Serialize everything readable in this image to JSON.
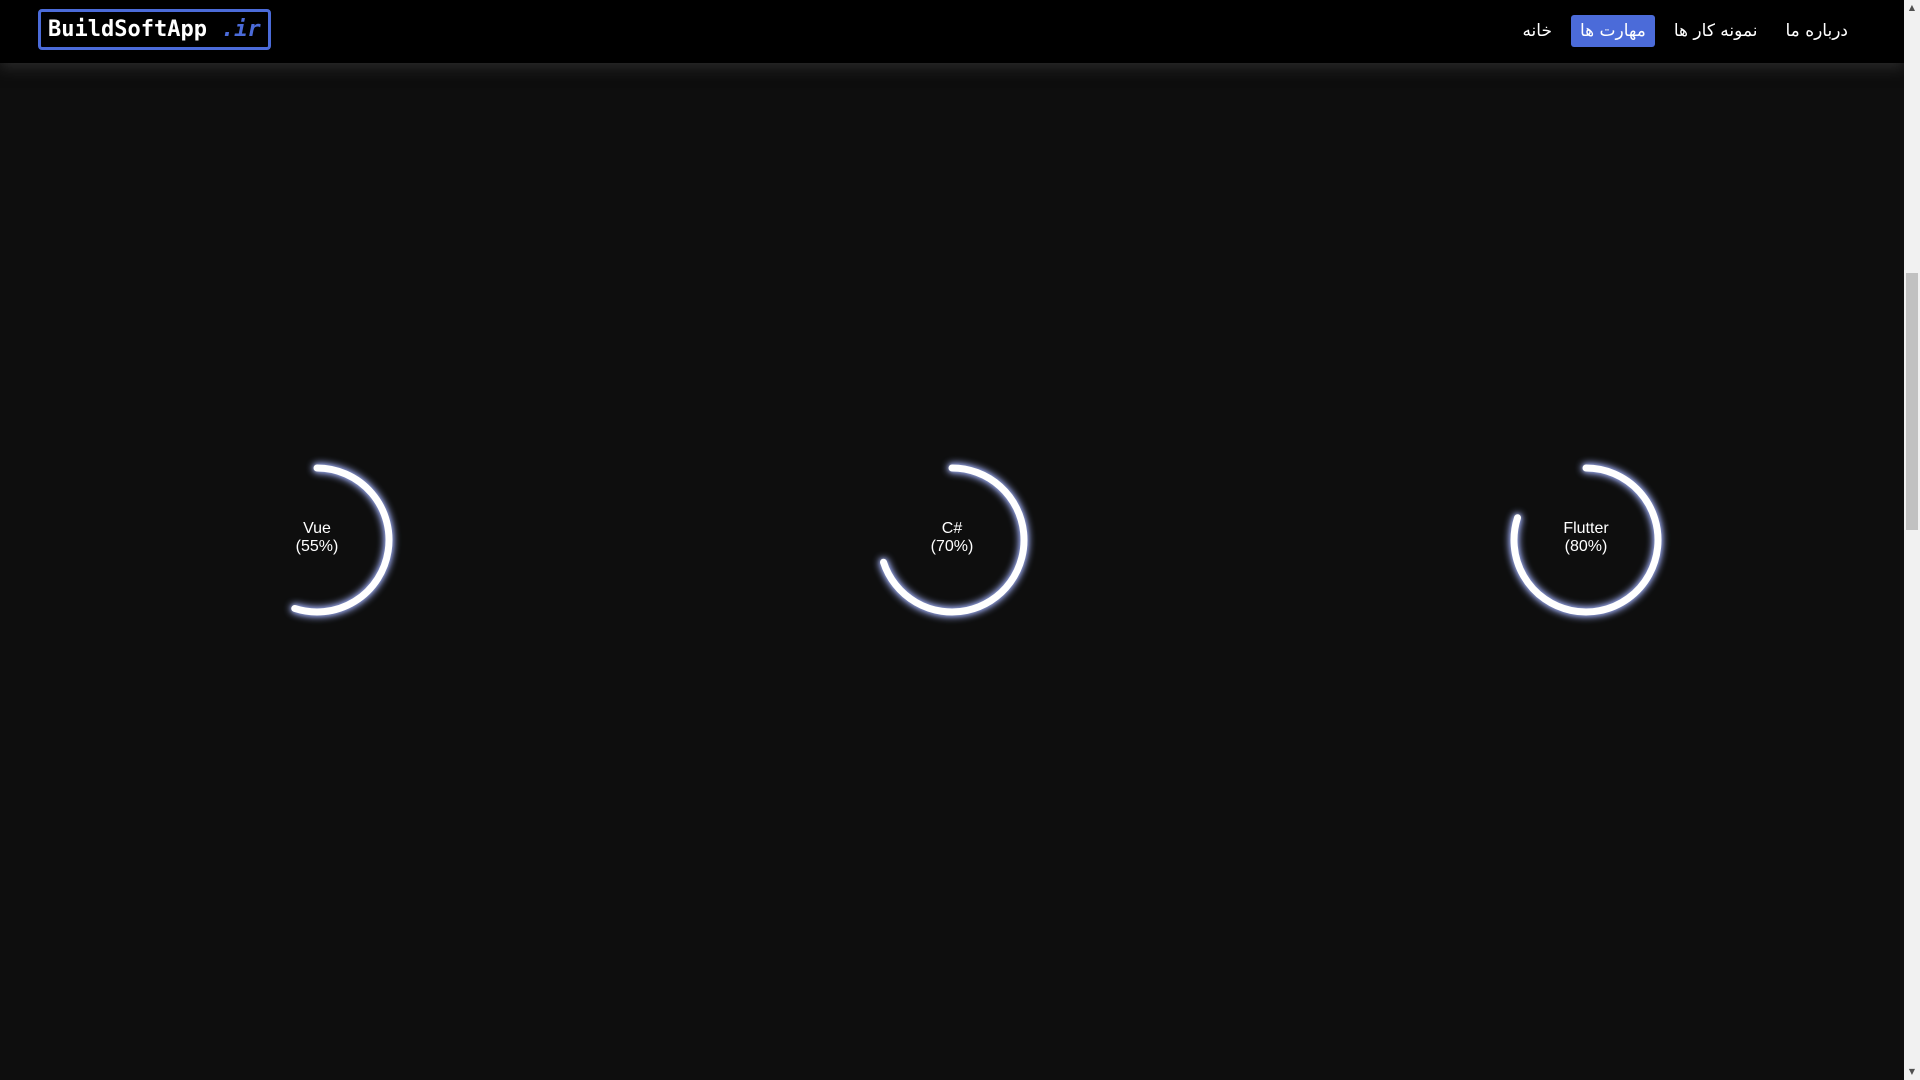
{
  "header": {
    "logo": {
      "name": "BuildSoftApp",
      "tld": ".ir",
      "accent_color": "#4b6bd9"
    },
    "nav": [
      {
        "label": "خانه",
        "active": false
      },
      {
        "label": "مهارت ها",
        "active": true
      },
      {
        "label": "نمونه کار ها",
        "active": false
      },
      {
        "label": "درباره ما",
        "active": false
      }
    ]
  },
  "skills": [
    {
      "name": "Vue",
      "percent_label": "(55%)",
      "percent": 55
    },
    {
      "name": "C#",
      "percent_label": "(70%)",
      "percent": 70
    },
    {
      "name": "Flutter",
      "percent_label": "(80%)",
      "percent": 80
    }
  ],
  "colors": {
    "background": "#0e0e0e",
    "navbar": "#000000",
    "accent": "#4b6bd9",
    "ring": "#ffffff"
  }
}
